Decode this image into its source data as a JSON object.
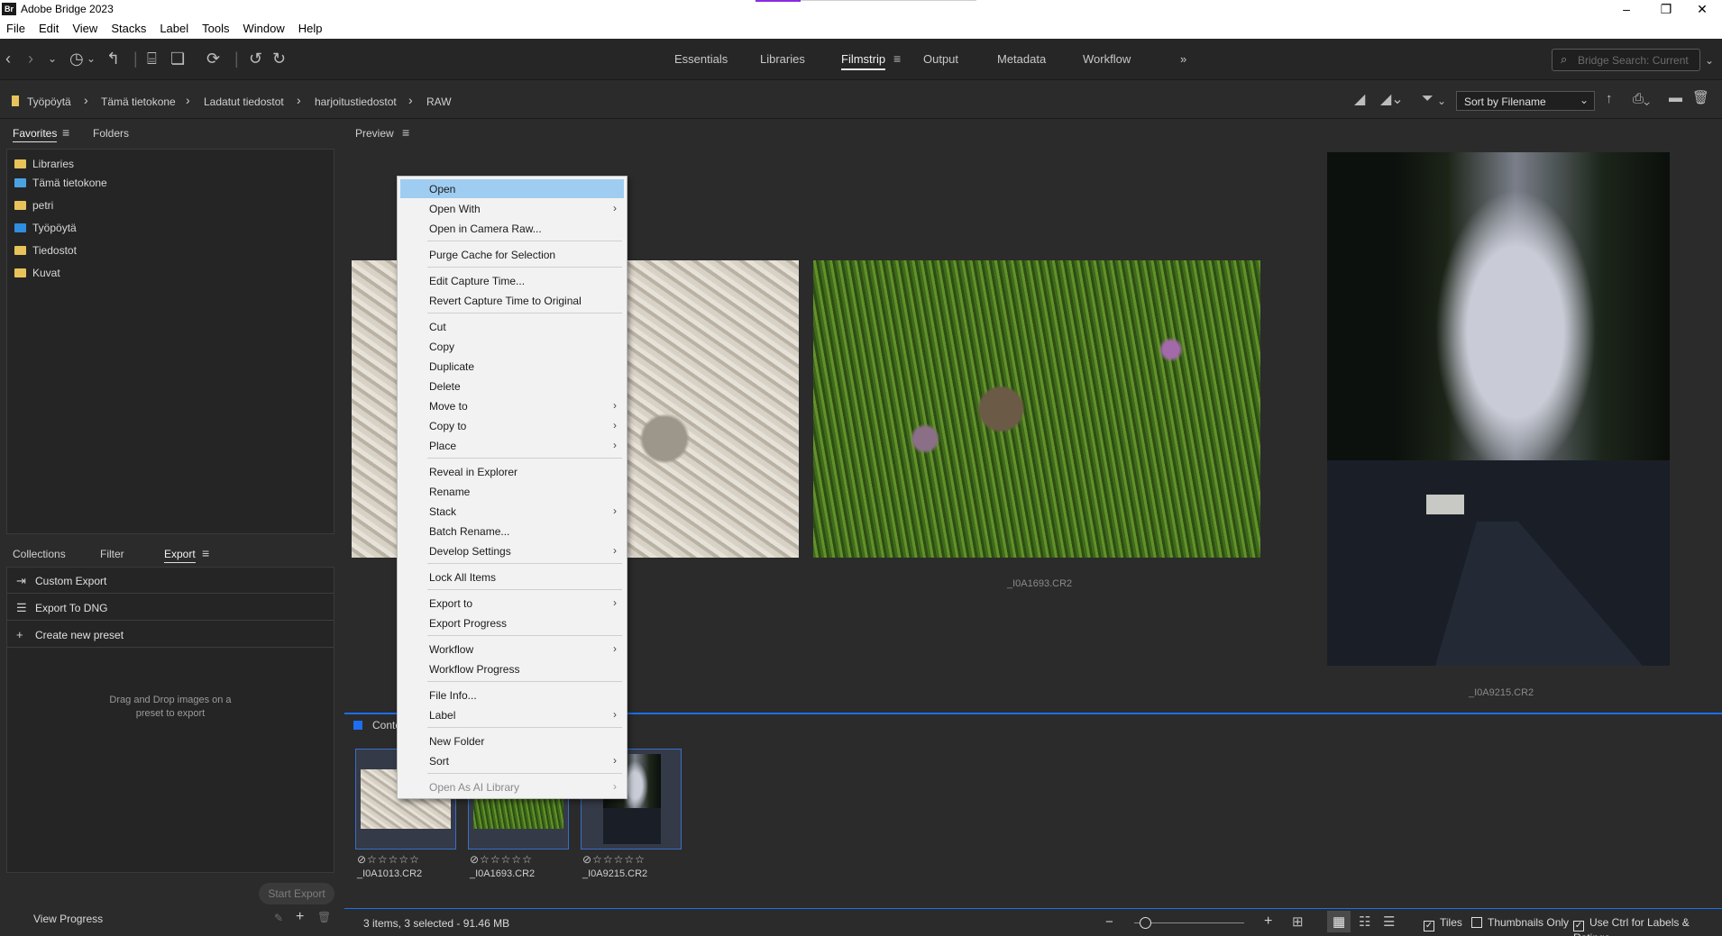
{
  "window": {
    "title": "Adobe Bridge 2023",
    "logo": "Br",
    "minimize": "–",
    "restore": "❐",
    "close": "✕"
  },
  "menubar": [
    "File",
    "Edit",
    "View",
    "Stacks",
    "Label",
    "Tools",
    "Window",
    "Help"
  ],
  "workspaces": {
    "tabs": [
      "Essentials",
      "Libraries",
      "Filmstrip",
      "Output",
      "Metadata",
      "Workflow"
    ],
    "active": "Filmstrip",
    "more": "»"
  },
  "search": {
    "placeholder": "Bridge Search: Current"
  },
  "breadcrumb": [
    "Työpöytä",
    "Tämä tietokone",
    "Ladatut tiedostot",
    "harjoitustiedostot",
    "RAW"
  ],
  "sort": {
    "label": "Sort by Filename"
  },
  "left_panel": {
    "tabs": {
      "favorites": "Favorites",
      "folders": "Folders"
    },
    "favorites": [
      {
        "label": "Libraries",
        "icon": "libraries-icon",
        "color": "#e7c35a"
      },
      {
        "label": "Tämä tietokone",
        "icon": "computer-icon",
        "color": "#4aa3df"
      },
      {
        "label": "petri",
        "icon": "user-folder-icon",
        "color": "#e7c35a"
      },
      {
        "label": "Työpöytä",
        "icon": "desktop-icon",
        "color": "#2f8ee0"
      },
      {
        "label": "Tiedostot",
        "icon": "documents-icon",
        "color": "#e7c35a"
      },
      {
        "label": "Kuvat",
        "icon": "pictures-icon",
        "color": "#e7c35a"
      }
    ],
    "bottom_tabs": {
      "collections": "Collections",
      "filter": "Filter",
      "export": "Export"
    },
    "export_items": [
      "Custom Export",
      "Export To DNG",
      "Create new preset"
    ],
    "drag_hint_line1": "Drag and Drop images on a",
    "drag_hint_line2": "preset to export",
    "start_export": "Start Export",
    "view_progress": "View Progress"
  },
  "preview": {
    "title": "Preview",
    "captions": [
      "_I0A1693.CR2",
      "_I0A9215.CR2"
    ]
  },
  "content": {
    "title": "Conte",
    "thumbnails": [
      {
        "name": "_I0A1013.CR2",
        "rating_text": "⊘☆☆☆☆☆"
      },
      {
        "name": "_I0A1693.CR2",
        "rating_text": "⊘☆☆☆☆☆"
      },
      {
        "name": "_I0A9215.CR2",
        "rating_text": "⊘☆☆☆☆☆"
      }
    ]
  },
  "status": {
    "text": "3 items, 3 selected - 91.46 MB",
    "tiles": "Tiles",
    "thumbnails_only": "Thumbnails Only",
    "use_ctrl": "Use Ctrl for Labels & Ratings"
  },
  "context_menu": {
    "items": [
      {
        "label": "Open",
        "highlight": true
      },
      {
        "label": "Open With",
        "submenu": true
      },
      {
        "label": "Open in Camera Raw..."
      },
      {
        "label": "Purge Cache for Selection"
      },
      {
        "label": "Edit Capture Time..."
      },
      {
        "label": "Revert Capture Time to Original"
      },
      {
        "label": "Cut"
      },
      {
        "label": "Copy"
      },
      {
        "label": "Duplicate"
      },
      {
        "label": "Delete"
      },
      {
        "label": "Move to",
        "submenu": true
      },
      {
        "label": "Copy to",
        "submenu": true
      },
      {
        "label": "Place",
        "submenu": true
      },
      {
        "label": "Reveal in Explorer"
      },
      {
        "label": "Rename"
      },
      {
        "label": "Stack",
        "submenu": true
      },
      {
        "label": "Batch Rename..."
      },
      {
        "label": "Develop Settings",
        "submenu": true
      },
      {
        "label": "Lock All Items"
      },
      {
        "label": "Export to",
        "submenu": true
      },
      {
        "label": "Export Progress"
      },
      {
        "label": "Workflow",
        "submenu": true
      },
      {
        "label": "Workflow Progress"
      },
      {
        "label": "File Info..."
      },
      {
        "label": "Label",
        "submenu": true
      },
      {
        "label": "New Folder"
      },
      {
        "label": "Sort",
        "submenu": true
      },
      {
        "label": "Open As AI Library",
        "submenu": true,
        "disabled": true
      }
    ]
  },
  "colors": {
    "accent_blue": "#1d6ef0",
    "highlight": "#9fcdf1"
  }
}
